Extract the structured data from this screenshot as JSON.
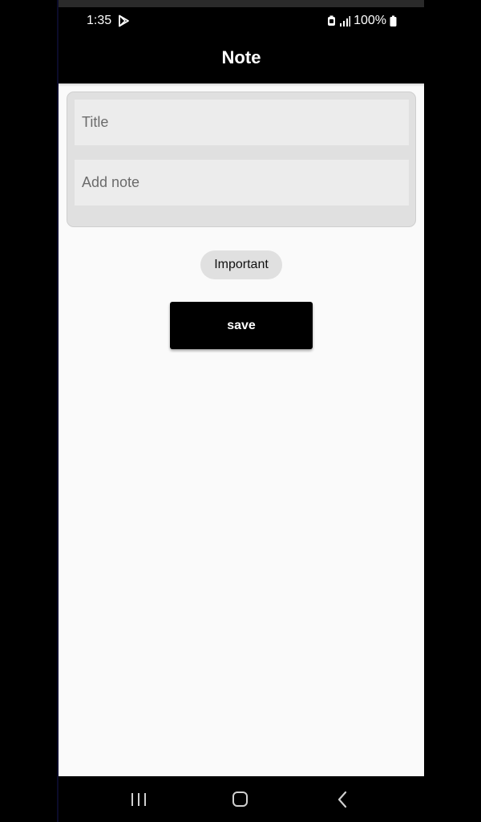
{
  "status_bar": {
    "time": "1:35",
    "battery": "100%"
  },
  "app_bar": {
    "title": "Note"
  },
  "form": {
    "title_placeholder": "Title",
    "title_value": "",
    "note_placeholder": "Add note",
    "note_value": ""
  },
  "chip": {
    "label": "Important"
  },
  "save_button": {
    "label": "save"
  },
  "icons": {
    "status": [
      "play-store-icon",
      "battery-saver-icon",
      "signal-icon",
      "battery-icon"
    ],
    "navigation": [
      "recents-icon",
      "home-icon",
      "back-icon"
    ]
  },
  "colors": {
    "app_bar": "#000000",
    "background": "#fafafa",
    "card": "#e0e0e0",
    "field": "#ececec",
    "chip": "#e0e0e0",
    "button": "#000000"
  }
}
